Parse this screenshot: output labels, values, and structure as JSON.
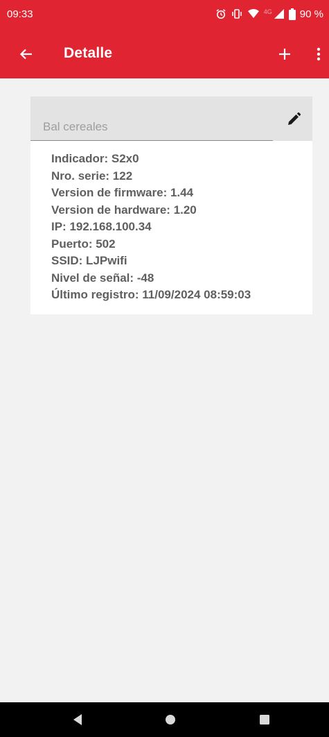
{
  "status_bar": {
    "time": "09:33",
    "network_type": "4G",
    "battery": "90 %",
    "icons": [
      "alarm-icon",
      "vibrate-icon",
      "wifi-icon",
      "signal-icon",
      "battery-icon"
    ]
  },
  "app_bar": {
    "title": "Detalle",
    "icons": [
      "back-arrow-icon",
      "add-icon",
      "more-vert-icon"
    ]
  },
  "device": {
    "name_placeholder": "Bal cereales",
    "edit_icon": "pencil-icon",
    "info": [
      "Indicador: S2x0",
      "Nro. serie: 122",
      "Version de firmware: 1.44",
      "Version de hardware: 1.20",
      "IP: 192.168.100.34",
      "Puerto: 502",
      "SSID: LJPwifi",
      "Nivel de señal: -48",
      "Último registro: 11/09/2024 08:59:03"
    ]
  },
  "nav_bar": {
    "icons": [
      "nav-back-icon",
      "nav-home-icon",
      "nav-recents-icon"
    ]
  },
  "colors": {
    "primary": "#e02432",
    "background": "#f2f2f2",
    "card": "#ffffff",
    "field": "#e3e3e3",
    "text": "#5f5f5f"
  }
}
